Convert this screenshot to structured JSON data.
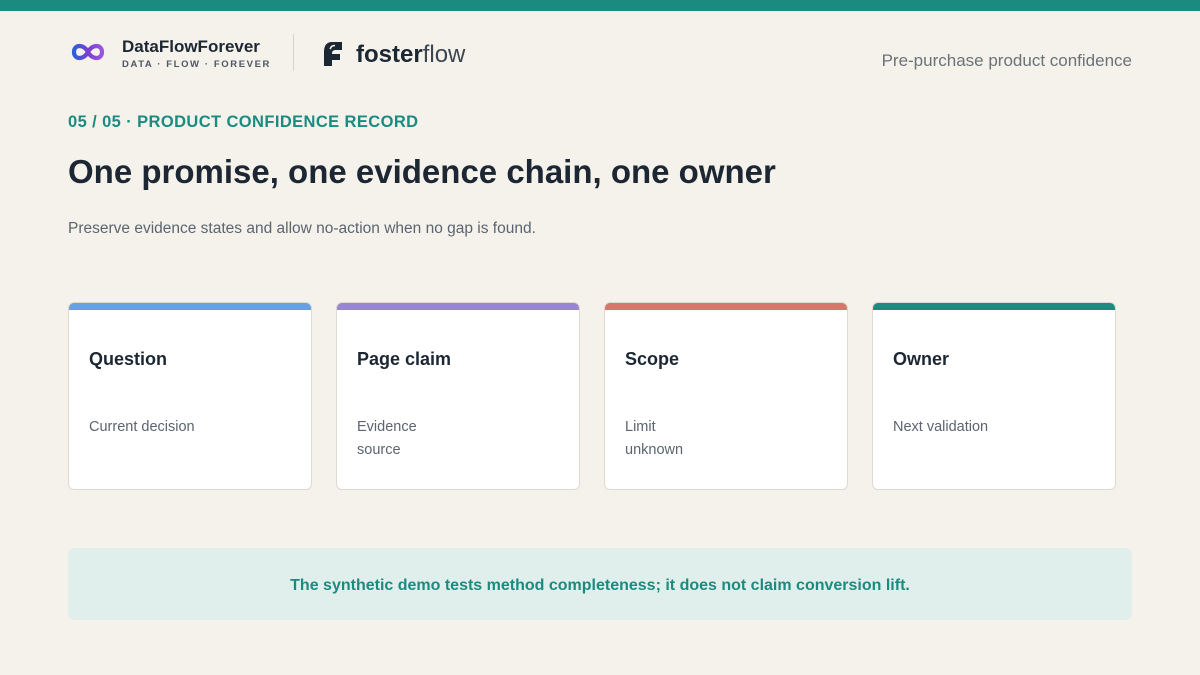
{
  "colors": {
    "accent": "#1b8b80",
    "background": "#f5f2eb",
    "note_background": "#e0efeb"
  },
  "header": {
    "brand": {
      "name": "DataFlowForever",
      "tagline": "DATA · FLOW · FOREVER",
      "icon": "infinity-logo-icon"
    },
    "partner": {
      "name_bold": "foster",
      "name_light": "flow",
      "icon": "leaf-logo-icon"
    },
    "caption": "Pre-purchase product confidence"
  },
  "eyebrow": "05 / 05 · PRODUCT CONFIDENCE RECORD",
  "title": "One promise, one evidence chain, one owner",
  "subtitle": "Preserve evidence states and allow no-action when no gap is found.",
  "cards": [
    {
      "title": "Question",
      "lines": [
        "Current decision"
      ],
      "stripe_color": "#6a9fe0"
    },
    {
      "title": "Page claim",
      "lines": [
        "Evidence",
        "source"
      ],
      "stripe_color": "#9a86cf"
    },
    {
      "title": "Scope",
      "lines": [
        "Limit",
        "unknown"
      ],
      "stripe_color": "#d7776c"
    },
    {
      "title": "Owner",
      "lines": [
        "Next validation"
      ],
      "stripe_color": "#1b8b80"
    }
  ],
  "note": "The synthetic demo tests method completeness; it does not claim conversion lift."
}
